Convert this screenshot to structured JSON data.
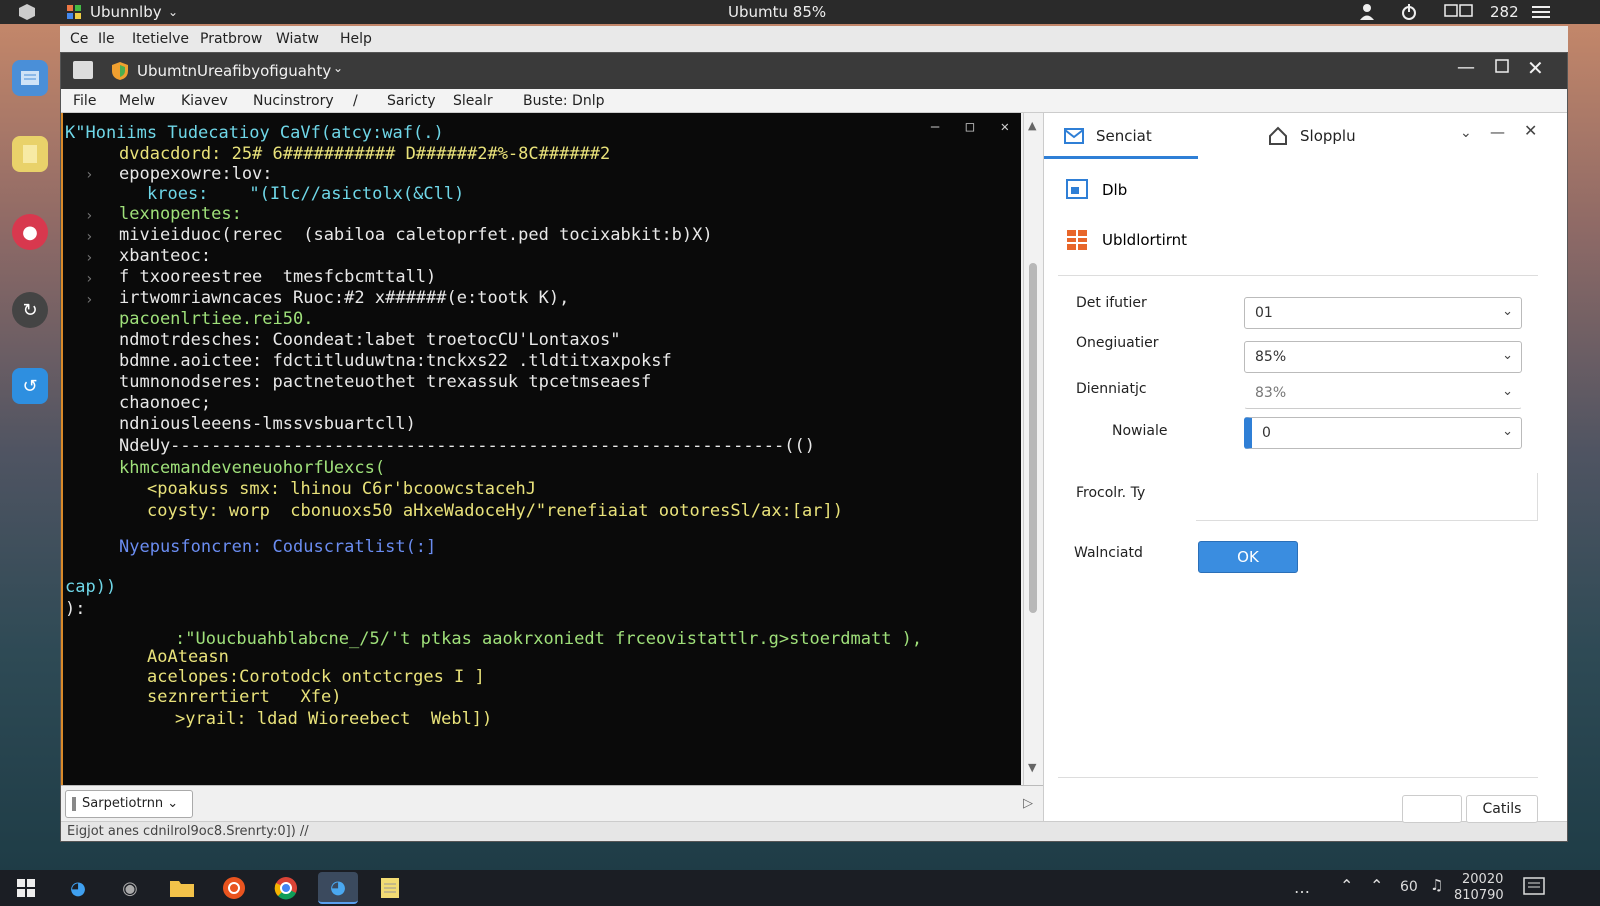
{
  "topbar": {
    "app_name": "Ubunnlby",
    "center_title": "Ubumtu 85%",
    "right_text": "282"
  },
  "outer_menu": [
    "Ce",
    "Ile",
    "Itetielve",
    "Pratbrow",
    "Wiatw",
    "Help"
  ],
  "window": {
    "title": "UbumtnUreafibyofiguahty"
  },
  "window_menu": [
    "File",
    "Melw",
    "Kiavev",
    "Nucinstrory",
    "/",
    "Saricty",
    "Slealr",
    "Buste: Dnlp"
  ],
  "terminal": {
    "lines": [
      {
        "text": "K\"Honiims Tudecatioy CaVf(atcy:waf(.)",
        "color": "c-c",
        "indent": 0
      },
      {
        "text": "dvdacdord: 25# 6########### D######2#%-8C######2",
        "color": "c-y",
        "indent": 1
      },
      {
        "text": "epopexowre:lov:",
        "color": "c-w",
        "indent": 1
      },
      {
        "text": "kroes:    \"(Ilc//asictolx(&Cll)",
        "color": "c-c",
        "indent": 2
      },
      {
        "text": "lexnopentes:",
        "color": "c-g",
        "indent": 1
      },
      {
        "text": "mivieiduoc(rerec  (sabiloa caletoprfet.ped tocixabkit:b)X)",
        "color": "c-w",
        "indent": 1
      },
      {
        "text": "xbanteoc:",
        "color": "c-w",
        "indent": 1
      },
      {
        "text": "f txooreestree  tmesfcbcmttall)",
        "color": "c-w",
        "indent": 1
      },
      {
        "text": "irtwomriawncaces Ruoc:#2 x######(e:tootk K),",
        "color": "c-w",
        "indent": 1
      },
      {
        "text": "pacoenlrtiee.rei50.",
        "color": "c-g",
        "indent": 1
      },
      {
        "text": "ndmotrdesches: Coondeat:labet troetocCU'Lontaxos\"",
        "color": "c-w",
        "indent": 1
      },
      {
        "text": "bdmne.aoictee: fdctitluduwtna:tnckxs22 .tldtitxaxpoksf",
        "color": "c-w",
        "indent": 1
      },
      {
        "text": "tumnonodseres: pactneteuothet trexassuk tpcetmseaesf",
        "color": "c-w",
        "indent": 1
      },
      {
        "text": "chaonoec;",
        "color": "c-w",
        "indent": 1
      },
      {
        "text": "ndniousleeens-lmssvsbuartcll)",
        "color": "c-w",
        "indent": 1
      },
      {
        "text": "NdeUy------------------------------------------------------------(()",
        "color": "c-w",
        "indent": 1
      },
      {
        "text": "khmcemandeveneuohorfUexcs(",
        "color": "c-g",
        "indent": 1
      },
      {
        "text": "<poakuss smx: lhinou C6r'bcoowcstacehJ",
        "color": "c-y",
        "indent": 2
      },
      {
        "text": "coysty: worp  cbonuoxs50 aHxeWadoceHy/\"renefiaiat ootoresSl/ax:[ar])",
        "color": "c-y",
        "indent": 2
      },
      {
        "text": "Nyepusfoncren: Coduscratlist(:]",
        "color": "c-b",
        "indent": 1
      },
      {
        "text": "cap))",
        "color": "c-c",
        "indent": 0
      },
      {
        "text": "):",
        "color": "c-w",
        "indent": 0
      },
      {
        "text": ":\"Uoucbuahblabcne_/5/'t ptkas aaokrxoniedt frceovistattlr.g>stoerdmatt ),",
        "color": "c-g",
        "indent": 3
      },
      {
        "text": "AoAteasn",
        "color": "c-y",
        "indent": 2
      },
      {
        "text": "acelopes:Corotodck ontctcrges I ]",
        "color": "c-y",
        "indent": 2
      },
      {
        "text": "seznrertiert   Xfe)",
        "color": "c-y",
        "indent": 2
      },
      {
        "text": ">yrail: ldad Wioreebect  Webl])",
        "color": "c-y",
        "indent": 3
      }
    ]
  },
  "bottom": {
    "select_label": "Sarpetiotrnn",
    "status_text": "Eigjot anes cdnilrol9oc8.Srenrty:0]) //"
  },
  "panel": {
    "tabs": [
      "Senciat",
      "Slopplu"
    ],
    "items": [
      "Dlb",
      "Ubldlortirnt"
    ],
    "fields": [
      {
        "label": "Det ifutier",
        "value": "01"
      },
      {
        "label": "Onegiuatier",
        "value": "85%"
      },
      {
        "label": "Dienniatjc",
        "value": "83%"
      },
      {
        "label": "Nowiale",
        "value": "0"
      }
    ],
    "frecolr_label": "Frocolr. Ty",
    "wainciatd_label": "Walnciatd",
    "ok_label": "OK",
    "cancel_label": "Catils"
  },
  "taskbar": {
    "clock_line1": "20020",
    "clock_line2": "810790",
    "tray_text": "60"
  },
  "colors": {
    "accent": "#2f7fd6",
    "terminal_border": "#d98a2a"
  }
}
